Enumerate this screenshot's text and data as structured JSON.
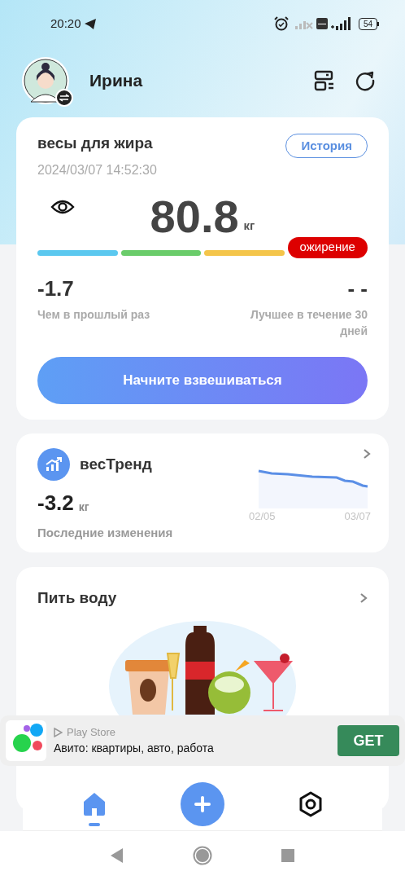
{
  "status_bar": {
    "time": "20:20",
    "battery": "54"
  },
  "header": {
    "user_name": "Ирина"
  },
  "scale_card": {
    "title": "весы для жира",
    "history_button": "История",
    "timestamp": "2024/03/07 14:52:30",
    "weight": "80.8",
    "unit": "кг",
    "segments": [
      {
        "color": "#5bc8ef"
      },
      {
        "color": "#6acc6a"
      },
      {
        "color": "#f4c54a"
      }
    ],
    "status": {
      "label": "ожирение",
      "color": "#dd0000"
    },
    "stats": [
      {
        "value": "-1.7",
        "label": "Чем в прошлый раз"
      },
      {
        "value": "- -",
        "label": "Лучшее в течение 30 дней"
      }
    ],
    "start_button": "Начните взвешиваться"
  },
  "trend_card": {
    "title": "весТренд",
    "value": "-3.2",
    "unit": "кг",
    "caption": "Последние изменения",
    "x_labels": [
      "02/05",
      "03/07"
    ]
  },
  "water_card": {
    "title": "Пить воду"
  },
  "ad": {
    "source": "Play Store",
    "title": "Авито: квартиры, авто, работа",
    "button": "GET"
  },
  "bottom_nav": [
    {
      "kind": "home",
      "selected": true
    },
    {
      "kind": "settings",
      "selected": false
    }
  ]
}
